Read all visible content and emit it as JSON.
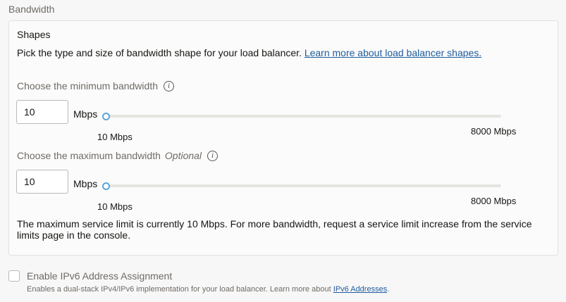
{
  "section_title": "Bandwidth",
  "shapes": {
    "title": "Shapes",
    "description": "Pick the type and size of bandwidth shape for your load balancer.",
    "learn_more_link": "Learn more about load balancer shapes."
  },
  "min_bandwidth": {
    "label": "Choose the minimum bandwidth",
    "value": "10",
    "unit": "Mbps",
    "slider_min_label": "10 Mbps",
    "slider_max_label": "8000 Mbps",
    "slider_value": 10,
    "slider_min": 10,
    "slider_max": 8000
  },
  "max_bandwidth": {
    "label": "Choose the maximum bandwidth",
    "optional": "Optional",
    "value": "10",
    "unit": "Mbps",
    "slider_min_label": "10 Mbps",
    "slider_max_label": "8000 Mbps",
    "slider_value": 10,
    "slider_min": 10,
    "slider_max": 8000
  },
  "service_limit_text": "The maximum service limit is currently 10 Mbps. For more bandwidth, request a service limit increase from the service limits page in the console.",
  "ipv6": {
    "label": "Enable IPv6 Address Assignment",
    "checked": false,
    "help_text": "Enables a dual-stack IPv4/IPv6 implementation for your load balancer. Learn more about",
    "help_link": "IPv6 Addresses",
    "help_suffix": "."
  }
}
